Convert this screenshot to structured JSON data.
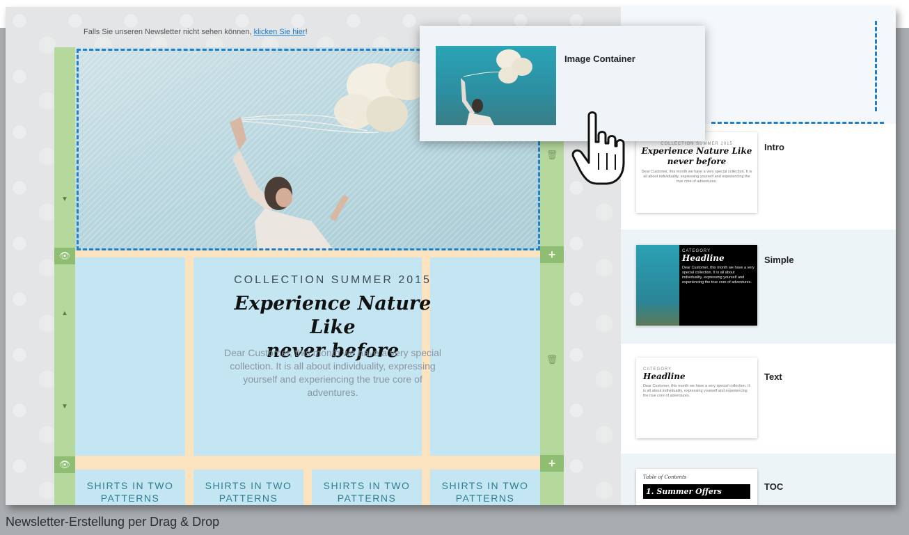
{
  "notice": {
    "text": "Falls Sie unseren Newsletter nicht sehen können, ",
    "link": "klicken Sie hier",
    "suffix": "!"
  },
  "content": {
    "collection": "COLLECTION SUMMER 2015",
    "headline_line1": "Experience Nature Like",
    "headline_line2": "never before",
    "body": "Dear Customer, this month we have a very special collection. It is all about individuality, expressing yourself and experiencing the true core of adventures."
  },
  "shirts": [
    {
      "line1": "SHIRTS IN TWO",
      "line2": "PATTERNS"
    },
    {
      "line1": "SHIRTS IN TWO",
      "line2": "PATTERNS"
    },
    {
      "line1": "SHIRTS IN TWO",
      "line2": "PATTERNS"
    },
    {
      "line1": "SHIRTS IN TWO",
      "line2": "PATTERNS"
    }
  ],
  "drag_card": {
    "title": "Image Container"
  },
  "templates": {
    "intro": {
      "name": "Intro",
      "collection": "COLLECTION SUMMER 2015",
      "headline_line1": "Experience Nature Like",
      "headline_line2": "never before",
      "body": "Dear Customer, this month we have a very special collection. It is all about individuality, expressing yourself and experiencing the true core of adventures."
    },
    "simple": {
      "name": "Simple",
      "category": "CATEGORY",
      "headline": "Headline",
      "body": "Dear Customer, this month we have a very special collection. It is all about individuality, expressing yourself and experiencing the true core of adventures."
    },
    "text": {
      "name": "Text",
      "category": "CATEGORY",
      "headline": "Headline",
      "body": "Dear Customer, this month we have a very special collection. It is all about individuality, expressing yourself and experiencing the true core of adventures."
    },
    "toc": {
      "name": "TOC",
      "toc_title": "Table of Contents",
      "item": "1. Summer Offers"
    }
  },
  "caption": "Newsletter-Erstellung per Drag & Drop",
  "colors": {
    "rail": "#b5d89c",
    "dash": "#1f7fc8",
    "cell": "#c4e6f2",
    "gap": "#fbe3c0"
  }
}
